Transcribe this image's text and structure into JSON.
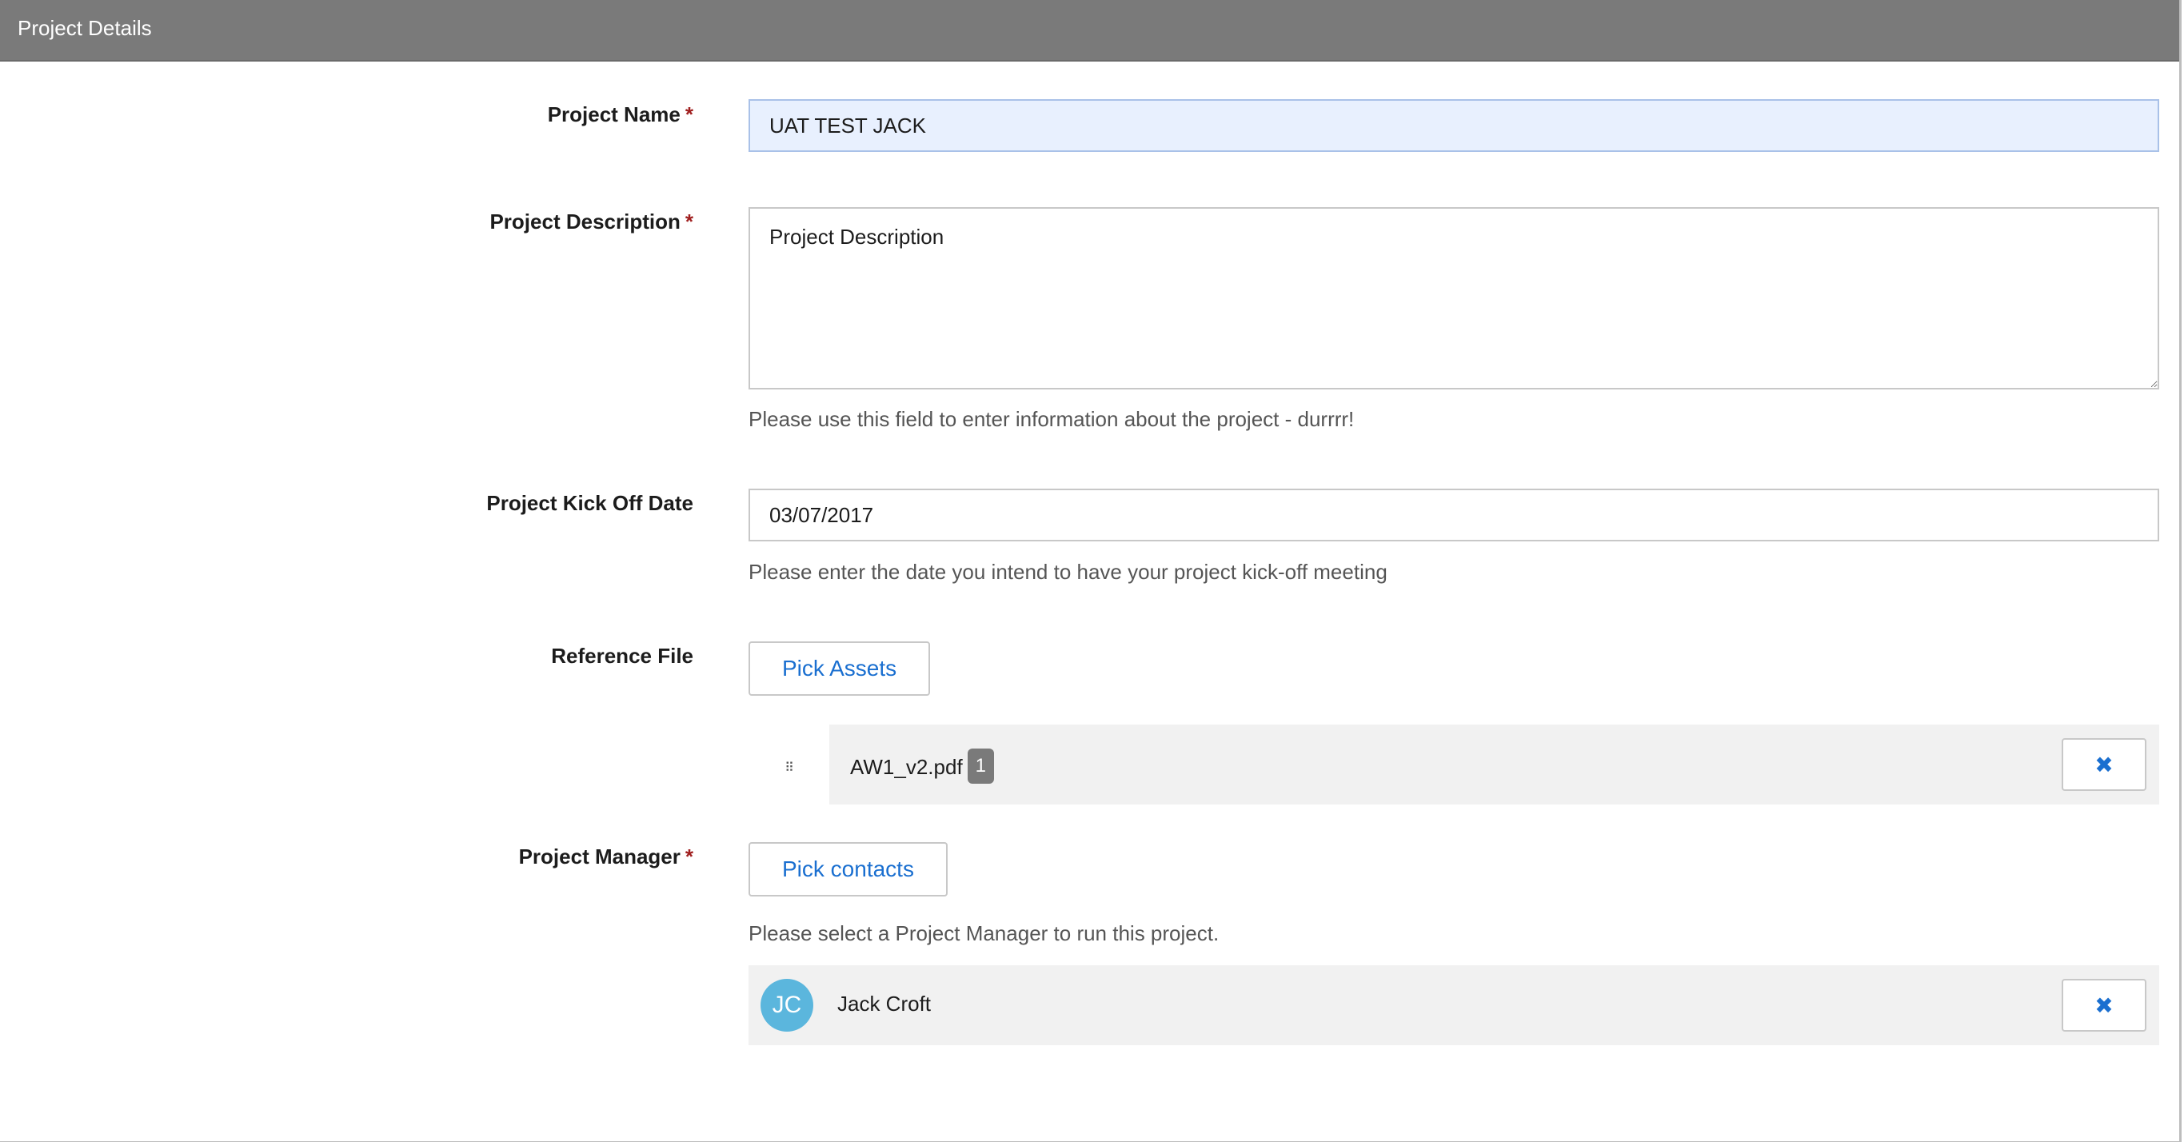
{
  "header": {
    "title": "Project Details"
  },
  "form": {
    "project_name": {
      "label": "Project Name",
      "required_marker": "*",
      "value": "UAT TEST JACK"
    },
    "project_description": {
      "label": "Project Description",
      "required_marker": "*",
      "value": "Project Description",
      "help": "Please use this field to enter information about the project - durrrr!"
    },
    "kick_off_date": {
      "label": "Project Kick Off Date",
      "value": "03/07/2017",
      "help": "Please enter the date you intend to have your project kick-off meeting"
    },
    "reference_file": {
      "label": "Reference File",
      "button_label": "Pick Assets",
      "drag_handle": "⠿",
      "items": [
        {
          "file_name": "AW1_v2.pdf",
          "badge": "1",
          "remove_icon": "✖"
        }
      ]
    },
    "project_manager": {
      "label": "Project Manager",
      "required_marker": "*",
      "button_label": "Pick contacts",
      "help": "Please select a Project Manager to run this project.",
      "contacts": [
        {
          "initials": "JC",
          "name": "Jack Croft",
          "remove_icon": "✖"
        }
      ]
    }
  },
  "colors": {
    "header_bg": "#7a7a7a",
    "accent": "#1a6fd0",
    "required": "#a01f1f",
    "avatar_bg": "#5bb6dd",
    "row_bg": "#f1f1f1",
    "active_input_bg": "#e8f0fe"
  }
}
